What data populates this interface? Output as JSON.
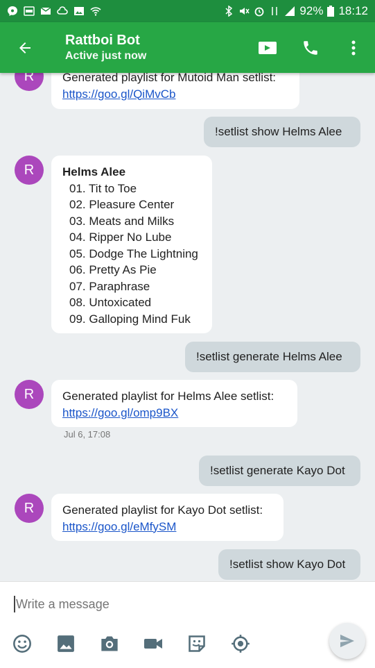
{
  "status": {
    "battery": "92%",
    "time": "18:12"
  },
  "header": {
    "title": "Rattboi Bot",
    "subtitle": "Active just now"
  },
  "avatar_letter": "R",
  "messages": [
    {
      "line1": "Generated playlist for Mutoid Man setlist:",
      "link": "https://goo.gl/QiMvCb"
    },
    {
      "out": "!setlist show Helms Alee"
    },
    {
      "setlist_title": "Helms Alee",
      "tracks": [
        "01. Tit to Toe",
        "02. Pleasure Center",
        "03. Meats and Milks",
        "04. Ripper No Lube",
        "05. Dodge The Lightning",
        "06. Pretty As Pie",
        "07. Paraphrase",
        "08. Untoxicated",
        "09. Galloping Mind Fuk"
      ]
    },
    {
      "out": "!setlist generate Helms Alee"
    },
    {
      "line1": "Generated playlist for Helms Alee setlist:",
      "link": "https://goo.gl/omp9BX",
      "time": "Jul 6, 17:08"
    },
    {
      "out": "!setlist generate Kayo Dot"
    },
    {
      "line1": "Generated playlist for Kayo Dot setlist:",
      "link": "https://goo.gl/eMfySM"
    },
    {
      "out": "!setlist show Kayo Dot"
    }
  ],
  "composer": {
    "placeholder": "Write a message"
  },
  "icons": [
    "back-arrow-icon",
    "video-call-icon",
    "phone-icon",
    "more-vert-icon",
    "emoji-icon",
    "image-icon",
    "camera-icon",
    "video-icon",
    "sticker-icon",
    "location-icon",
    "send-icon"
  ],
  "colors": {
    "status_bar": "#1e8e3e",
    "app_bar": "#27a745",
    "avatar": "#ab47bc",
    "outgoing_bubble": "#cfd8dc",
    "link": "#1a55c9"
  }
}
